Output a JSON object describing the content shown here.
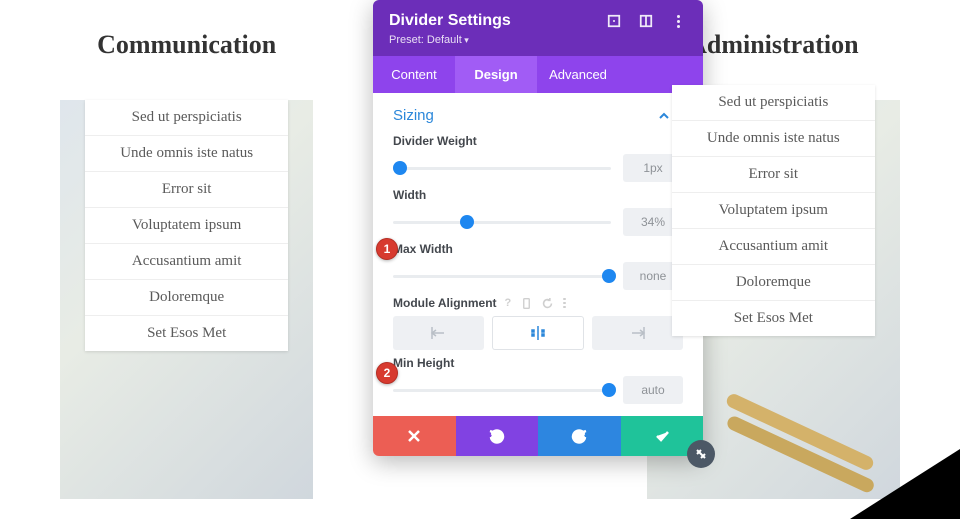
{
  "columns": {
    "left": {
      "title": "Communication",
      "items": [
        "Sed ut perspiciatis",
        "Unde omnis iste natus",
        "Error sit",
        "Voluptatem ipsum",
        "Accusantium amit",
        "Doloremque",
        "Set Esos Met"
      ]
    },
    "right": {
      "title": "Administration",
      "items": [
        "Sed ut perspiciatis",
        "Unde omnis iste natus",
        "Error sit",
        "Voluptatem ipsum",
        "Accusantium amit",
        "Doloremque",
        "Set Esos Met"
      ]
    }
  },
  "modal": {
    "title": "Divider Settings",
    "preset": "Preset: Default",
    "tabs": [
      "Content",
      "Design",
      "Advanced"
    ],
    "active_tab": 1,
    "section": "Sizing",
    "opts": {
      "divider_weight": {
        "label": "Divider Weight",
        "value": "1px",
        "pct": 3
      },
      "width": {
        "label": "Width",
        "value": "34%",
        "pct": 34
      },
      "max_width": {
        "label": "Max Width",
        "value": "none",
        "pct": 99
      },
      "module_align": {
        "label": "Module Alignment"
      },
      "min_height": {
        "label": "Min Height",
        "value": "auto",
        "pct": 99
      }
    }
  },
  "annotations": {
    "badge1": "1",
    "badge2": "2"
  }
}
